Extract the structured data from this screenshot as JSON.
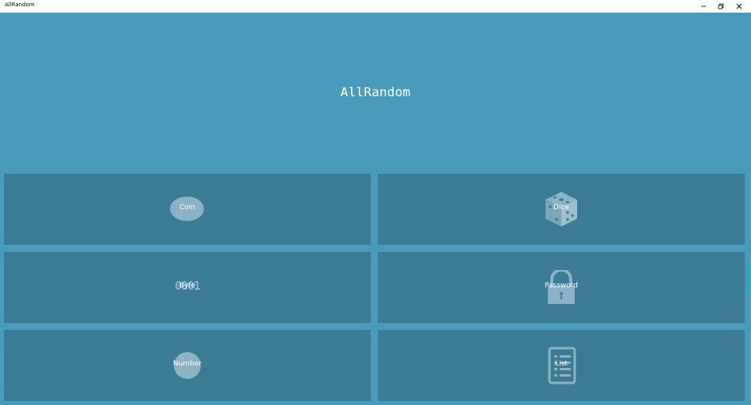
{
  "window": {
    "title": "AllRandom"
  },
  "header": {
    "title": "AllRandom"
  },
  "tiles": [
    {
      "label": "Coin",
      "icon": "coin-icon"
    },
    {
      "label": "Dice",
      "icon": "dice-icon"
    },
    {
      "label": "Byte",
      "icon": "binary-icon",
      "glyph_text": "0001"
    },
    {
      "label": "Password",
      "icon": "lock-icon"
    },
    {
      "label": "Number",
      "icon": "number-icon"
    },
    {
      "label": "List",
      "icon": "list-icon"
    }
  ],
  "colors": {
    "background": "#4a9bba",
    "tile": "#3b7b93",
    "glyph": "#8ab4c4",
    "text": "#ffffff"
  }
}
